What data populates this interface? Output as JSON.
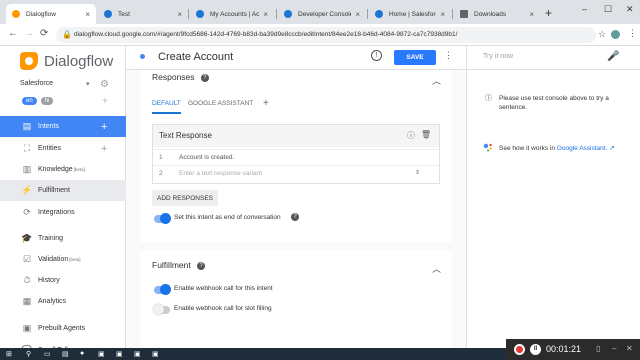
{
  "browser": {
    "tabs": [
      {
        "label": "Dialogflow",
        "fav": "#ff9800"
      },
      {
        "label": "Test",
        "fav": "#1976d2"
      },
      {
        "label": "My Accounts | Accounts",
        "fav": "#1976d2"
      },
      {
        "label": "Developer Console",
        "fav": "#1976d2"
      },
      {
        "label": "Home | Salesforce",
        "fav": "#1976d2"
      },
      {
        "label": "Downloads",
        "fav": "#5f6368"
      }
    ],
    "new_tab": "+",
    "window_controls": [
      "–",
      "☐",
      "✕"
    ],
    "url": "dialogflow.cloud.google.com/#/agent/9fcd5686-142d-4769-b83d-ba39d9e8cccb/editIntent/84ee2e18-b46d-4084-9872-ca7c7938d9b1/"
  },
  "sidebar": {
    "brand": "Dialogflow",
    "agent": "Salesforce",
    "languages": [
      "en",
      "hi"
    ],
    "items": [
      {
        "label": "Intents",
        "icon": "▤",
        "plus": true,
        "state": "active"
      },
      {
        "label": "Entities",
        "icon": "⛶",
        "plus": true,
        "state": ""
      },
      {
        "label": "Knowledge",
        "beta": "[beta]",
        "icon": "▥",
        "plus": false,
        "state": ""
      },
      {
        "label": "Fulfillment",
        "icon": "⚡",
        "plus": false,
        "state": "dim"
      },
      {
        "label": "Integrations",
        "icon": "⟳",
        "plus": false,
        "state": ""
      },
      {
        "label": "Training",
        "icon": "🎓",
        "plus": false,
        "state": ""
      },
      {
        "label": "Validation",
        "beta": "[beta]",
        "icon": "☑",
        "plus": false,
        "state": ""
      },
      {
        "label": "History",
        "icon": "⏱",
        "plus": false,
        "state": ""
      },
      {
        "label": "Analytics",
        "icon": "▦",
        "plus": false,
        "state": ""
      },
      {
        "label": "Prebuilt Agents",
        "icon": "▣",
        "plus": false,
        "state": ""
      },
      {
        "label": "Small Talk",
        "icon": "💬",
        "plus": false,
        "state": ""
      }
    ]
  },
  "header": {
    "title": "Create Account",
    "save_label": "SAVE"
  },
  "responses": {
    "title": "Responses",
    "tabs": {
      "default": "DEFAULT",
      "assistant": "GOOGLE ASSISTANT",
      "add": "+"
    },
    "text_response_title": "Text Response",
    "rows": [
      {
        "num": "1",
        "value": "Account is created."
      },
      {
        "num": "2",
        "placeholder": "Enter a text response variant"
      }
    ],
    "add_responses_label": "ADD RESPONSES",
    "end_conversation_label": "Set this intent as end of conversation",
    "end_conversation_on": true
  },
  "fulfillment": {
    "title": "Fulfillment",
    "webhook_label": "Enable webhook call for this intent",
    "webhook_on": true,
    "slot_label": "Enable webhook call for slot filling",
    "slot_on": false
  },
  "console": {
    "placeholder": "Try it now",
    "info": "Please use test console above to try a sentence.",
    "ga_prefix": "See how it works in ",
    "ga_link": "Google Assistant."
  },
  "recorder": {
    "timer": "00:01:21"
  }
}
